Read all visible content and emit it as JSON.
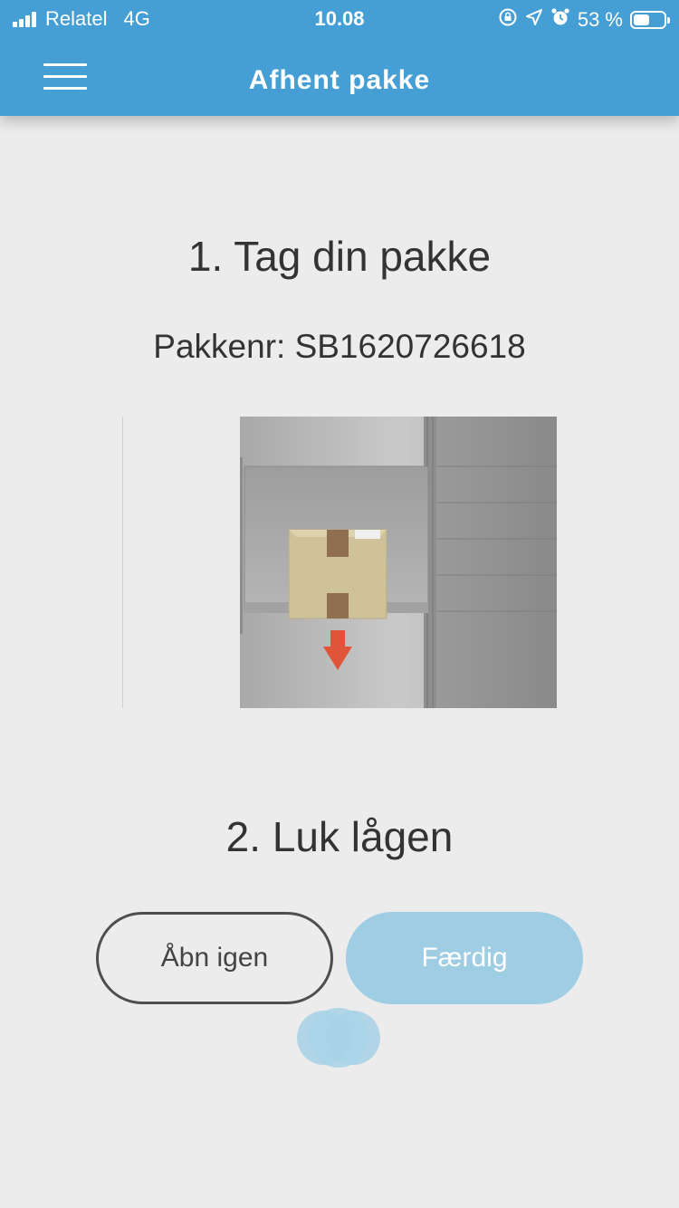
{
  "status_bar": {
    "carrier": "Relatel",
    "network": "4G",
    "time": "10.08",
    "battery": "53 %",
    "battery_level": 0.53,
    "icons": [
      "rotation-lock-icon",
      "location-arrow-icon",
      "alarm-icon",
      "battery-icon"
    ]
  },
  "header": {
    "title": "Afhent pakke",
    "menu_icon": "hamburger-menu-icon"
  },
  "main": {
    "step1_title": "1. Tag din pakke",
    "package_number": "Pakkenr: SB1620726618",
    "step2_title": "2. Luk lågen"
  },
  "buttons": {
    "reopen_label": "Åbn igen",
    "done_label": "Færdig"
  },
  "colors": {
    "header": "#459fd4",
    "background": "#ececec",
    "done_button": "#9ecde4",
    "arrow": "#e0553a"
  }
}
